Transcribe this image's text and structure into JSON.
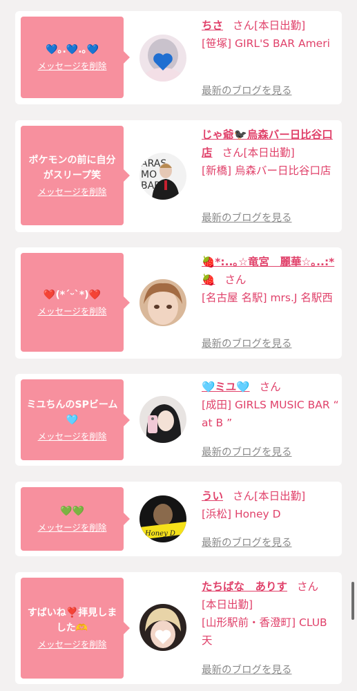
{
  "delete_label": "メッセージを削除",
  "blog_label": "最新のブログを見る",
  "cards": [
    {
      "message": "💙｡.💙.｡💙",
      "name": "ちさ",
      "honorific": "さん",
      "status": "[本日出勤]",
      "shop": "[笹塚] GIRL'S BAR Ameri",
      "avatar_icon": "blue-heart-icon"
    },
    {
      "message": "ポケモンの前に自分がスリープ笑",
      "name": "じゃ爺🐦‍⬛烏森バー日比谷口店",
      "honorific": "さん",
      "status": "[本日出勤]",
      "shop": "[新橋] 烏森バー日比谷口店",
      "avatar_icon": "staff-photo"
    },
    {
      "message": "❤️(*´ᵕ`*)❤️",
      "name": "🍓*:..｡☆竜宮　麗華☆｡..:*🍓",
      "honorific": "さん",
      "status": "",
      "shop": "[名古屋 名駅] mrs.J 名駅西",
      "avatar_icon": "portrait-photo"
    },
    {
      "message": "ミユちんのSPビーム🩵",
      "name": "🩵ミユ🩵",
      "honorific": "さん",
      "status": "",
      "shop": "[成田] GIRLS MUSIC BAR “ at B ”",
      "avatar_icon": "selfie-photo"
    },
    {
      "message": "💚💚",
      "name": "うい",
      "honorific": "さん",
      "status": "[本日出勤]",
      "shop": "[浜松] Honey D",
      "avatar_icon": "honey-logo-photo"
    },
    {
      "message": "すばいね❣️拝見しました🫶",
      "name": "たちばな　ありす",
      "honorific": "さん",
      "status": "[本日出勤]",
      "shop": "[山形駅前・香澄町] CLUB 天",
      "avatar_icon": "white-heart-icon"
    }
  ],
  "colors": {
    "bubble": "#f7909e",
    "accent": "#e0416a",
    "muted": "#8a8a8a",
    "background": "#f3f1f1"
  }
}
